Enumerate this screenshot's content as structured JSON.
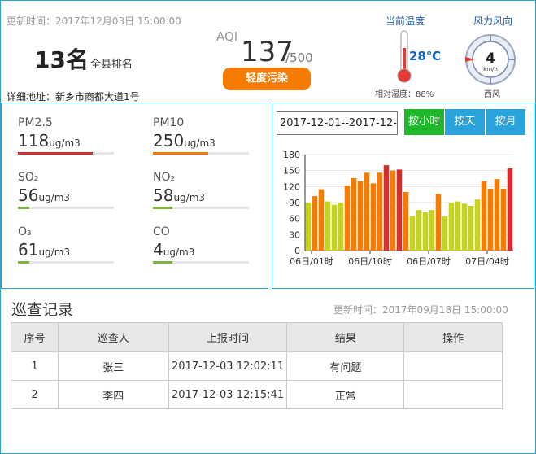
{
  "header": {
    "update_time": "更新时间：2017年12月03日 15:00:00",
    "rank_number": "13名",
    "rank_label": "全县排名",
    "address": "详细地址：新乡市商都大道1号"
  },
  "aqi": {
    "label": "AQI",
    "value": "137",
    "max": "/500",
    "level": "轻度污染",
    "level_color": "#f57c00"
  },
  "weather": {
    "temp_title": "当前温度",
    "temperature": "28℃",
    "humidity": "相对湿度：88%",
    "wind_title": "风力风向",
    "wind_speed": "4",
    "wind_unit": "km/h",
    "wind_direction": "西风"
  },
  "pollutants": [
    {
      "name": "PM2.5",
      "value": "118",
      "unit": "ug/m3",
      "level_fraction": 0.78,
      "color": "#d32f2f"
    },
    {
      "name": "PM10",
      "value": "250",
      "unit": "ug/m3",
      "level_fraction": 0.58,
      "color": "#f57c00"
    },
    {
      "name": "SO₂",
      "value": "56",
      "unit": "ug/m3",
      "level_fraction": 0.12,
      "color": "#7cb342"
    },
    {
      "name": "NO₂",
      "value": "58",
      "unit": "ug/m3",
      "level_fraction": 0.2,
      "color": "#7cb342"
    },
    {
      "name": "O₃",
      "value": "61",
      "unit": "ug/m3",
      "level_fraction": 0.12,
      "color": "#7cb342"
    },
    {
      "name": "CO",
      "value": "4",
      "unit": "ug/m3",
      "level_fraction": 0.2,
      "color": "#7cb342"
    }
  ],
  "chart_controls": {
    "date_range": "2017-12-01--2017-12-03",
    "btn_hour": "按小时",
    "btn_day": "按天",
    "btn_month": "按月"
  },
  "chart_data": {
    "type": "bar",
    "ylim": [
      0,
      180
    ],
    "yticks": [
      0,
      30,
      60,
      90,
      120,
      150,
      180
    ],
    "x_tick_labels": [
      "06日/01时",
      "06日/10时",
      "06日/07时",
      "07日/04时"
    ],
    "grid": true,
    "values": [
      90,
      102,
      115,
      92,
      86,
      90,
      122,
      136,
      130,
      146,
      126,
      146,
      160,
      150,
      152,
      110,
      65,
      76,
      72,
      76,
      106,
      64,
      90,
      92,
      88,
      84,
      96,
      130,
      116,
      134,
      116,
      154
    ],
    "colors": [
      "#c6d31d",
      "#f57c00",
      "#f57c00",
      "#c6d31d",
      "#c6d31d",
      "#c6d31d",
      "#f57c00",
      "#f57c00",
      "#f57c00",
      "#f57c00",
      "#f57c00",
      "#f57c00",
      "#d32f2f",
      "#f57c00",
      "#d32f2f",
      "#f57c00",
      "#c6d31d",
      "#c6d31d",
      "#c6d31d",
      "#c6d31d",
      "#f57c00",
      "#c6d31d",
      "#c6d31d",
      "#c6d31d",
      "#c6d31d",
      "#c6d31d",
      "#c6d31d",
      "#f57c00",
      "#f57c00",
      "#f57c00",
      "#f57c00",
      "#d32f2f"
    ]
  },
  "records": {
    "title": "巡查记录",
    "update_time": "更新时间：2017年09月18日 15:00:00",
    "headers": [
      "序号",
      "巡查人",
      "上报时间",
      "结果",
      "操作"
    ],
    "rows": [
      [
        "1",
        "张三",
        "2017-12-03 12:02:11",
        "有问题",
        ""
      ],
      [
        "2",
        "李四",
        "2017-12-03 12:15:41",
        "正常",
        ""
      ]
    ]
  }
}
